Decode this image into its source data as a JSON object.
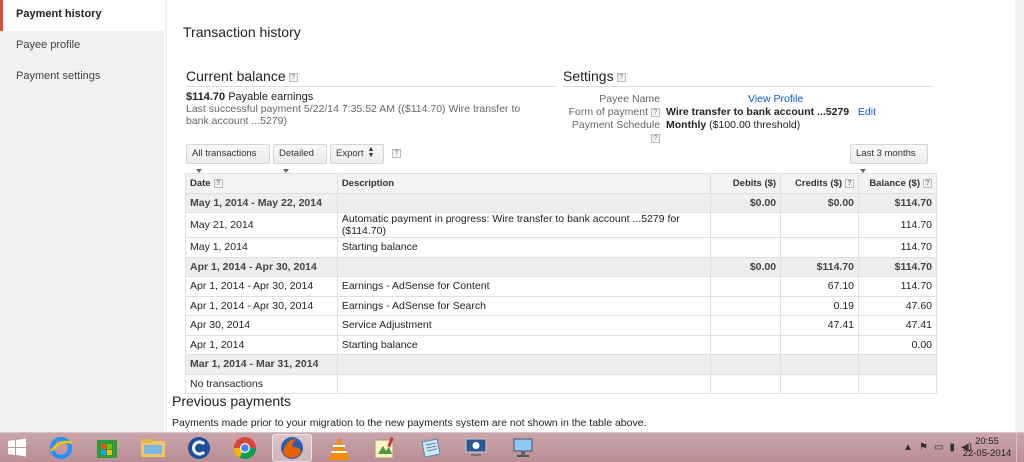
{
  "sidebar": {
    "items": [
      {
        "label": "Payment history"
      },
      {
        "label": "Payee profile"
      },
      {
        "label": "Payment settings"
      }
    ]
  },
  "main": {
    "title": "Transaction history",
    "current_balance": {
      "heading": "Current balance",
      "amount": "$114.70",
      "amount_label": "Payable earnings",
      "last_payment": "Last successful payment 5/22/14 7:35:52 AM (($114.70) Wire transfer to bank account ...5279)"
    },
    "settings": {
      "heading": "Settings",
      "payee_name_label": "Payee Name",
      "payee_name_link": "View Profile",
      "form_label": "Form of payment",
      "form_value": "Wire transfer to bank account ...5279",
      "form_edit": "Edit",
      "schedule_label": "Payment Schedule",
      "schedule_value": "Monthly",
      "schedule_threshold": "($100.00 threshold)"
    },
    "toolbar": {
      "filter": "All transactions",
      "detail": "Detailed",
      "export": "Export",
      "range": "Last 3 months"
    },
    "table": {
      "headers": {
        "date": "Date",
        "description": "Description",
        "debits": "Debits ($)",
        "credits": "Credits ($)",
        "balance": "Balance ($)"
      },
      "rows": [
        {
          "type": "period",
          "date": "May 1, 2014 - May 22, 2014",
          "description": "",
          "debits": "$0.00",
          "credits": "$0.00",
          "balance": "$114.70"
        },
        {
          "type": "row",
          "date": "May 21, 2014",
          "description": "Automatic payment in progress: Wire transfer to bank account ...5279 for ($114.70)",
          "debits": "",
          "credits": "",
          "balance": "114.70"
        },
        {
          "type": "row",
          "date": "May 1, 2014",
          "description": "Starting balance",
          "debits": "",
          "credits": "",
          "balance": "114.70"
        },
        {
          "type": "period",
          "date": "Apr 1, 2014 - Apr 30, 2014",
          "description": "",
          "debits": "$0.00",
          "credits": "$114.70",
          "balance": "$114.70"
        },
        {
          "type": "row",
          "date": "Apr 1, 2014 - Apr 30, 2014",
          "description": "Earnings - AdSense for Content",
          "debits": "",
          "credits": "67.10",
          "balance": "114.70"
        },
        {
          "type": "row",
          "date": "Apr 1, 2014 - Apr 30, 2014",
          "description": "Earnings - AdSense for Search",
          "debits": "",
          "credits": "0.19",
          "balance": "47.60"
        },
        {
          "type": "row",
          "date": "Apr 30, 2014",
          "description": "Service Adjustment",
          "debits": "",
          "credits": "47.41",
          "balance": "47.41"
        },
        {
          "type": "row",
          "date": "Apr 1, 2014",
          "description": "Starting balance",
          "debits": "",
          "credits": "",
          "balance": "0.00"
        },
        {
          "type": "period",
          "date": "Mar 1, 2014 - Mar 31, 2014",
          "description": "",
          "debits": "",
          "credits": "",
          "balance": ""
        },
        {
          "type": "row",
          "date": "No transactions",
          "description": "",
          "debits": "",
          "credits": "",
          "balance": ""
        }
      ]
    },
    "previous": {
      "title": "Previous payments",
      "note": "Payments made prior to your migration to the new payments system are not shown in the table above."
    }
  },
  "taskbar": {
    "apps": [
      "ie-icon",
      "store-icon",
      "file-explorer-icon",
      "ccleaner-icon",
      "chrome-icon",
      "firefox-icon",
      "vlc-icon",
      "paint-icon",
      "notepad-icon",
      "remote-desktop-icon",
      "network-icon"
    ],
    "time": "20:55",
    "date": "22-05-2014"
  },
  "colors": {
    "accent": "#dd4b39",
    "link": "#1155cc",
    "taskbar": "#bf959b"
  }
}
